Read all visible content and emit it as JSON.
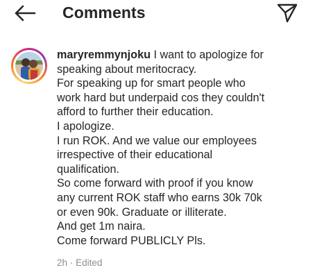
{
  "header": {
    "title": "Comments"
  },
  "comment": {
    "username": "maryremmynjoku",
    "first_line": "I want to apologize for",
    "lines": [
      "speaking about meritocracy.",
      "For speaking up for smart people who",
      "work hard but underpaid cos they couldn't",
      "afford to further their education.",
      "I apologize.",
      "I run ROK. And we value our employees",
      "irrespective of their educational",
      "qualification.",
      "So come forward with proof if you know",
      "any current ROK staff who earns 30k 70k",
      "or even 90k. Graduate or illiterate.",
      "And get 1m naira.",
      "Come forward PUBLICLY Pls."
    ],
    "time": "2h",
    "separator": "·",
    "edited_label": "Edited"
  },
  "icons": {
    "back": "arrow-left-icon",
    "share": "paper-plane-icon"
  },
  "colors": {
    "text": "#262626",
    "meta": "#8e8e8e",
    "background": "#ffffff"
  }
}
